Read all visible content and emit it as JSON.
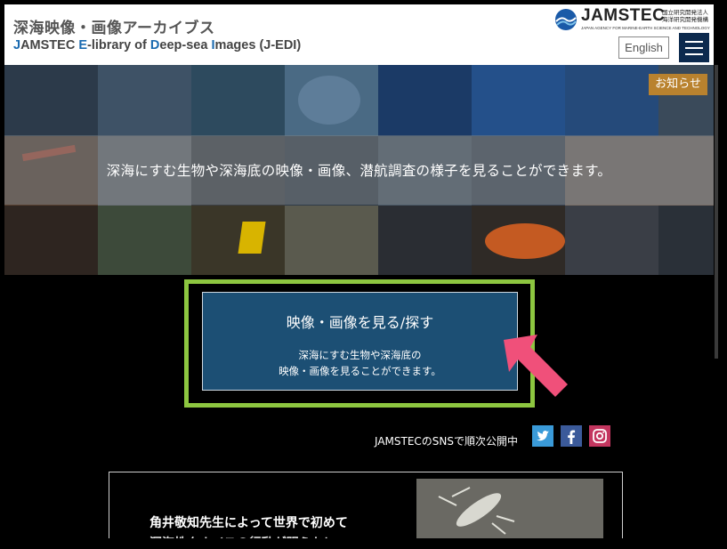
{
  "header": {
    "title": "深海映像・画像アーカイブス",
    "subtitle_parts": [
      "J",
      "AMSTEC ",
      "E",
      "-library of ",
      "D",
      "eep-sea ",
      "I",
      "mages (J-EDI)"
    ],
    "logo_text": "JAMSTEC",
    "logo_jp_line1": "国立研究開発法人",
    "logo_jp_line2": "海洋研究開発機構",
    "logo_en": "JAPAN AGENCY FOR MARINE-EARTH SCIENCE AND TECHNOLOGY",
    "english_label": "English",
    "menu_icon": "hamburger-icon"
  },
  "hero": {
    "caption": "深海にすむ生物や深海底の映像・画像、潜航調査の様子を見ることができます。",
    "notice_label": "お知らせ"
  },
  "cta": {
    "title": "映像・画像を見る/探す",
    "line1": "深海にすむ生物や深海底の",
    "line2": "映像・画像を見ることができます。",
    "highlight_color": "#8dc640",
    "arrow_color": "#f0507a"
  },
  "sns": {
    "label": "JAMSTECのSNSで順次公開中",
    "icons": [
      "twitter-icon",
      "facebook-icon",
      "instagram-icon"
    ]
  },
  "article": {
    "line1": "角井敬知先生によって世界で初めて",
    "line2": "深海性タナイスの行動が明らかに"
  }
}
